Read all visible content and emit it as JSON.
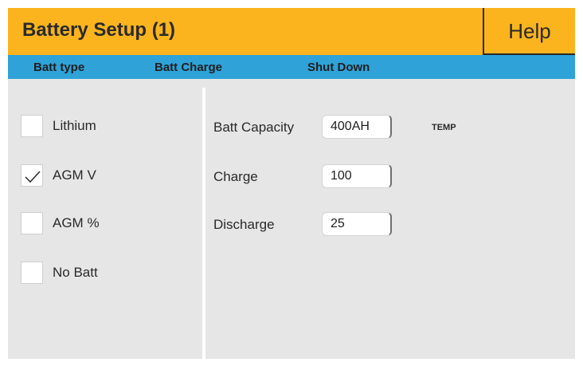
{
  "header": {
    "title": "Battery Setup (1)",
    "help_label": "Help",
    "accent_color": "#fbb41e"
  },
  "tabs": [
    {
      "label": "Batt type"
    },
    {
      "label": "Batt Charge"
    },
    {
      "label": "Shut Down"
    }
  ],
  "tab_bar_color": "#2fa2d8",
  "battery_types": [
    {
      "label": "Lithium",
      "checked": false
    },
    {
      "label": "AGM V",
      "checked": true
    },
    {
      "label": "AGM %",
      "checked": false
    },
    {
      "label": "No Batt",
      "checked": false
    }
  ],
  "settings": {
    "capacity": {
      "label": "Batt Capacity",
      "value": "400AH"
    },
    "charge": {
      "label": "Charge",
      "value": "100"
    },
    "discharge": {
      "label": "Discharge",
      "value": "25"
    },
    "temp_label": "TEMP"
  }
}
